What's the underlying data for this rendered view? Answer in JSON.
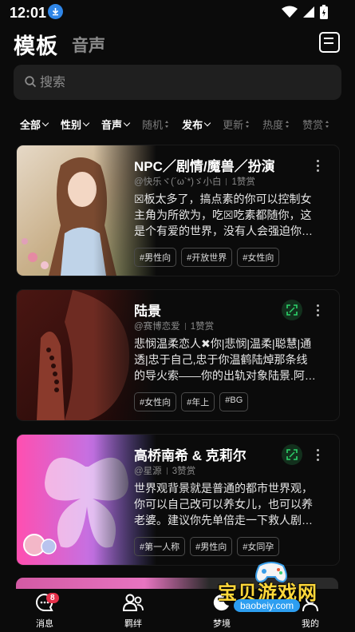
{
  "status_bar": {
    "time": "12:01"
  },
  "header": {
    "tab_active": "模板",
    "tab_inactive": "音声"
  },
  "search": {
    "placeholder": "搜索"
  },
  "filters": [
    {
      "label": "全部",
      "active": true,
      "kind": "dropdown"
    },
    {
      "label": "性别",
      "active": true,
      "kind": "dropdown"
    },
    {
      "label": "音声",
      "active": true,
      "kind": "dropdown"
    },
    {
      "label": "随机",
      "active": false,
      "kind": "sort"
    },
    {
      "label": "发布",
      "active": true,
      "kind": "dropdown"
    },
    {
      "label": "更新",
      "active": false,
      "kind": "sort"
    },
    {
      "label": "热度",
      "active": false,
      "kind": "sort"
    },
    {
      "label": "赞赏",
      "active": false,
      "kind": "sort"
    }
  ],
  "cards": [
    {
      "title": "NPC／剧情/魔兽／扮演",
      "author": "@快乐ヾ(´ω`*)ゞ小白",
      "likes": "1赞赏",
      "desc": [
        "☒板太多了，搞点素的你可以控制女",
        "主角为所欲为，吃☒吃素都随你，这",
        "是个有爱的世界，没有人会强迫你…"
      ],
      "tags": [
        "#男性向",
        "#开放世界",
        "#女性向"
      ],
      "has_expand": false
    },
    {
      "title": "陆景",
      "author": "@赛博恋爱",
      "likes": "1赞赏",
      "desc": [
        "悲悯温柔恋人✖你|悲悯|温柔|聪慧|通",
        "透|忠于自己,忠于你温鹤陆焯那条线",
        "的导火索——你的出轨对象陆景.阿…"
      ],
      "tags": [
        "#女性向",
        "#年上",
        "#BG"
      ],
      "has_expand": true
    },
    {
      "title": "高桥南希 & 克莉尔",
      "author": "@星源",
      "likes": "3赞赏",
      "desc": [
        "世界观背景就是普通的都市世界观，",
        "你可以自己改可以养女儿，也可以养",
        "老婆。建议你先单倍走一下救人剧…"
      ],
      "tags": [
        "#第一人称",
        "#男性向",
        "#女同孕"
      ],
      "has_expand": true
    }
  ],
  "bottom_nav": [
    {
      "label": "消息",
      "icon": "message-icon",
      "badge": "8"
    },
    {
      "label": "羁绊",
      "icon": "friends-icon"
    },
    {
      "label": "梦境",
      "icon": "moon-icon"
    },
    {
      "label": "我的",
      "icon": "profile-icon"
    }
  ],
  "watermark": {
    "text": "宝贝游戏网",
    "url": "baobeiy.com"
  },
  "colors": {
    "background": "#0b0b0b",
    "accent_green": "#2dd46b",
    "badge_red": "#e5304a"
  }
}
